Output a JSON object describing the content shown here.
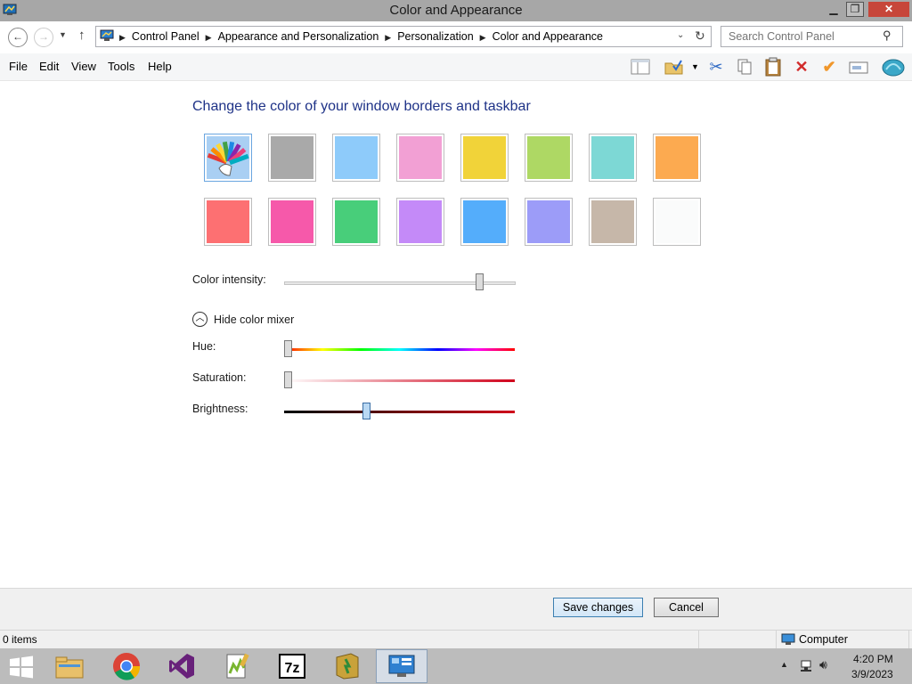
{
  "window": {
    "title": "Color and Appearance"
  },
  "title_buttons": {
    "minimize": "▁",
    "maximize": "❐",
    "close": "✕"
  },
  "address": {
    "crumbs": [
      "Control Panel",
      "Appearance and Personalization",
      "Personalization",
      "Color and Appearance"
    ]
  },
  "search": {
    "placeholder": "Search Control Panel"
  },
  "menu": [
    "File",
    "Edit",
    "View",
    "Tools",
    "Help"
  ],
  "toolbar_icons": [
    "pane-icon",
    "folder-check-icon",
    "cut-icon",
    "copy-icon",
    "paste-icon",
    "delete-icon",
    "check-icon",
    "rename-icon",
    "shell-icon"
  ],
  "main": {
    "heading": "Change the color of your window borders and taskbar",
    "swatches": [
      "#auto",
      "#a9a9a9",
      "#8ecbfa",
      "#f2a0d4",
      "#f1d339",
      "#aed864",
      "#7dd8d5",
      "#fcaa50",
      "#fd7072",
      "#f659aa",
      "#48ce7a",
      "#c48af8",
      "#54adfb",
      "#9c9cf8",
      "#c6b7a9",
      "#fafbfb"
    ],
    "intensity_label": "Color intensity:",
    "intensity_value": 0.86,
    "mixer_toggle": "Hide color mixer",
    "hue_label": "Hue:",
    "hue_value": 0.0,
    "saturation_label": "Saturation:",
    "saturation_value": 0.0,
    "brightness_label": "Brightness:",
    "brightness_value": 0.35
  },
  "buttons": {
    "save": "Save changes",
    "cancel": "Cancel"
  },
  "status": {
    "items": "0 items",
    "location": "Computer"
  },
  "taskbar": {
    "apps": [
      "file-explorer-icon",
      "chrome-icon",
      "visual-studio-icon",
      "notepad-plus-plus-icon",
      "seven-zip-icon",
      "book-icon",
      "control-panel-icon"
    ],
    "time": "4:20 PM",
    "date": "3/9/2023"
  },
  "colors": {
    "heading": "#1e3287",
    "taskbar": "#bcbcbc",
    "titlebar": "#a7a7a7"
  }
}
